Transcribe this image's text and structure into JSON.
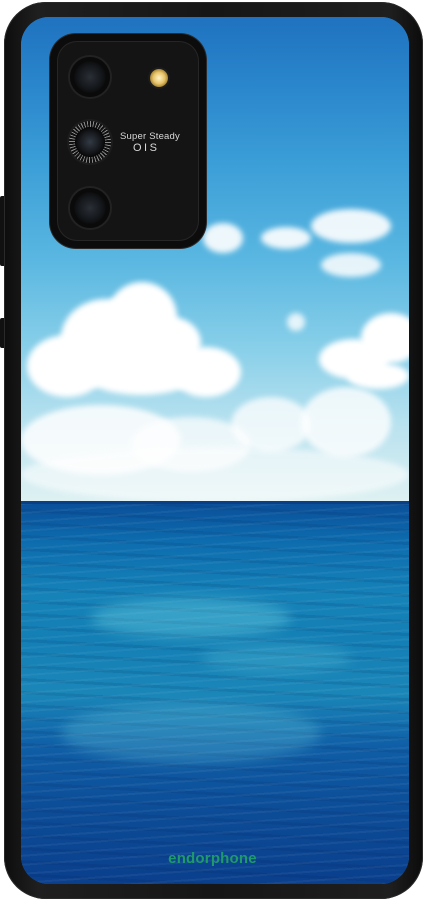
{
  "image": {
    "subject": "phone-case",
    "camera_module": {
      "label_line1": "Super Steady",
      "label_line2": "OIS"
    },
    "brand_mark": "endorphone",
    "colors": {
      "case": "#161616",
      "sky_top": "#1f72bf",
      "sky_horizon": "#dff1f2",
      "sea_deep": "#0a3f8c",
      "sea_mid": "#1582b8",
      "brand_green": "#1f9a6a"
    }
  }
}
